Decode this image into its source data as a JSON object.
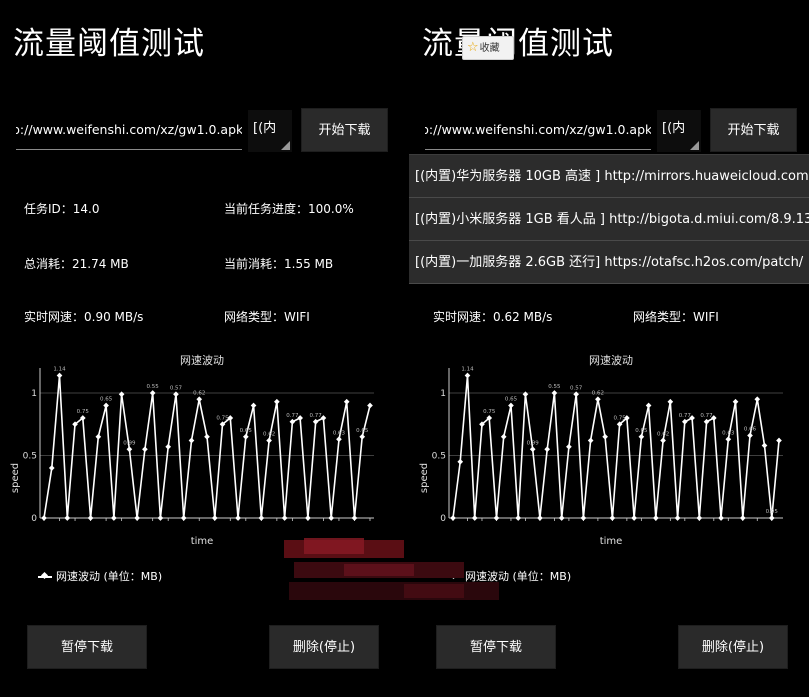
{
  "screens": [
    {
      "title": "流量阈值测试",
      "url_value": "p://www.weifenshi.com/xz/gw1.0.apk",
      "spinner_text": "[(内",
      "download_button": "开始下载",
      "task_id": "任务ID：14.0",
      "progress": "当前任务进度：100.0%",
      "total": "总消耗：21.74 MB",
      "current": "当前消耗：1.55 MB",
      "speed": "实时网速：0.90 MB/s",
      "network": "网络类型：WIFI",
      "pause_button": "暂停下载",
      "delete_button": "删除(停止)"
    },
    {
      "title": "流量阈值测试",
      "url_value": "p://www.weifenshi.com/xz/gw1.0.apk",
      "spinner_text": "[(内",
      "download_button": "开始下载",
      "speed": "实时网速：0.62 MB/s",
      "network": "网络类型：WIFI",
      "pause_button": "暂停下载",
      "delete_button": "删除(停止)"
    }
  ],
  "dropdown_options": [
    "[(内置)华为服务器 10GB 高速 ] http://mirrors.huaweicloud.com",
    "[(内置)小米服务器 1GB 看人品 ] http://bigota.d.miui.com/8.9.13",
    "[(内置)一加服务器 2.6GB 还行] https://otafsc.h2os.com/patch/"
  ],
  "favorite_popup": {
    "icon": "star-icon",
    "label": "收藏"
  },
  "chart_data": [
    {
      "type": "line",
      "title": "网速波动",
      "xlabel": "time",
      "ylabel": "speed",
      "ylim": [
        0,
        1.2
      ],
      "yticks": [
        "0",
        "0.5",
        "1"
      ],
      "grid": true,
      "legend_position": "bottom-left",
      "series": [
        {
          "name": "网速波动 (单位：MB)",
          "values": [
            0,
            0.4,
            1.14,
            0,
            0.75,
            0.8,
            0,
            0.65,
            0.9,
            0,
            0.99,
            0.55,
            0,
            0.55,
            1.0,
            0,
            0.57,
            0.99,
            0,
            0.62,
            0.95,
            0.65,
            0,
            0.75,
            0.8,
            0,
            0.65,
            0.9,
            0,
            0.62,
            0.93,
            0,
            0.77,
            0.8,
            0,
            0.77,
            0.8,
            0,
            0.63,
            0.93,
            0,
            0.65,
            0.9
          ]
        }
      ],
      "value_labels": [
        "1.14",
        "0.75",
        "0.65",
        "0.99",
        "0.55",
        "0.57",
        "0.62",
        "0.75",
        "0.65",
        "0.62",
        "0.77",
        "0.77",
        "0.63",
        "0.65"
      ]
    },
    {
      "type": "line",
      "title": "网速波动",
      "xlabel": "time",
      "ylabel": "speed",
      "ylim": [
        0,
        1.2
      ],
      "yticks": [
        "0",
        "0.5",
        "1"
      ],
      "grid": true,
      "legend_position": "bottom-left",
      "series": [
        {
          "name": "网速波动 (单位：MB)",
          "values": [
            0,
            0.45,
            1.14,
            0,
            0.75,
            0.8,
            0,
            0.65,
            0.9,
            0,
            0.99,
            0.55,
            0,
            0.55,
            1.0,
            0,
            0.57,
            0.99,
            0,
            0.62,
            0.95,
            0.65,
            0,
            0.75,
            0.8,
            0,
            0.65,
            0.9,
            0,
            0.62,
            0.93,
            0,
            0.77,
            0.8,
            0,
            0.77,
            0.8,
            0,
            0.63,
            0.93,
            0,
            0.66,
            0.95,
            0.58,
            0,
            0.62
          ]
        }
      ],
      "value_labels": [
        "1.14",
        "0.75",
        "0.65",
        "0.99",
        "0.55",
        "0.57",
        "0.62",
        "0.75",
        "0.65",
        "0.62",
        "0.77",
        "0.77",
        "0.63",
        "0.66",
        "0.95",
        "0.62"
      ]
    }
  ]
}
